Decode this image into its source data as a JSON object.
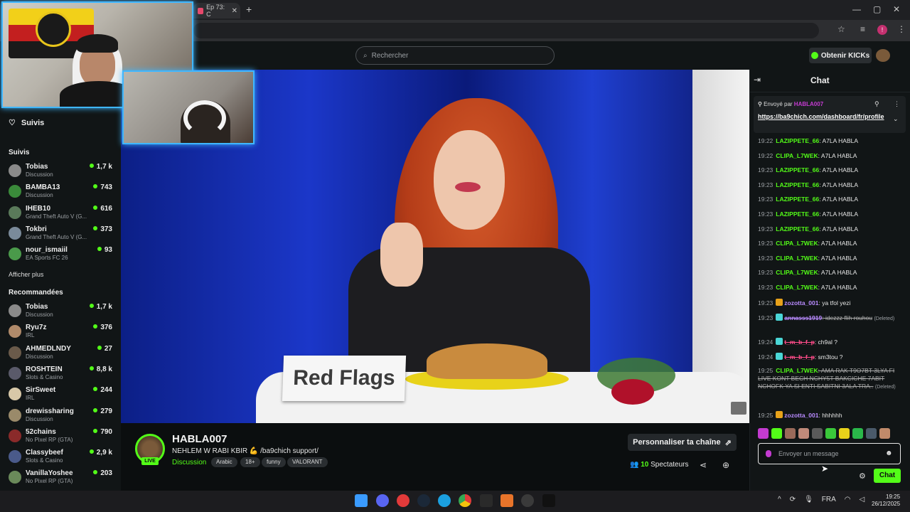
{
  "browser": {
    "tab_title": "Ep 73: C",
    "new_tab": "+",
    "close": "✕",
    "window": {
      "minimize": "—",
      "maximize": "▢",
      "close": "✕"
    },
    "profile_initial": "!"
  },
  "header": {
    "search_placeholder": "Rechercher",
    "kicks_label": "Obtenir KICKs"
  },
  "sidebar": {
    "suivis_header": "Suivis",
    "suivis_section": "Suivis",
    "followed": [
      {
        "name": "Tobias",
        "category": "Discussion",
        "viewers": "1,7 k",
        "color": "#8a8a8a"
      },
      {
        "name": "BAMBA13",
        "category": "Discussion",
        "viewers": "743",
        "color": "#3a8a3a"
      },
      {
        "name": "IHEB10",
        "category": "Grand Theft Auto V (G...",
        "viewers": "616",
        "color": "#5a7a5a"
      },
      {
        "name": "Tokbri",
        "category": "Grand Theft Auto V (G...",
        "viewers": "373",
        "color": "#7a8a9a"
      },
      {
        "name": "nour_ismaiil",
        "category": "EA Sports FC 26",
        "viewers": "93",
        "color": "#4a9a4a"
      }
    ],
    "show_more": "Afficher plus",
    "recommended_title": "Recommandées",
    "recommended": [
      {
        "name": "Tobias",
        "category": "Discussion",
        "viewers": "1,7 k",
        "color": "#8a8a8a"
      },
      {
        "name": "Ryu7z",
        "category": "IRL",
        "viewers": "376",
        "color": "#b08a6a"
      },
      {
        "name": "AHMEDLNDY",
        "category": "Discussion",
        "viewers": "27",
        "color": "#6a5a4a"
      },
      {
        "name": "ROSHTEIN",
        "category": "Slots & Casino",
        "viewers": "8,8 k",
        "color": "#5a5a6a"
      },
      {
        "name": "SirSweet",
        "category": "IRL",
        "viewers": "244",
        "color": "#d8c8a8"
      },
      {
        "name": "drewissharing",
        "category": "Discussion",
        "viewers": "279",
        "color": "#9a8a6a"
      },
      {
        "name": "52chains",
        "category": "No Pixel RP (GTA)",
        "viewers": "790",
        "color": "#8a2a2a"
      },
      {
        "name": "Classybeef",
        "category": "Slots & Casino",
        "viewers": "2,9 k",
        "color": "#4a5a8a"
      },
      {
        "name": "VanillaYoshee",
        "category": "No Pixel RP (GTA)",
        "viewers": "203",
        "color": "#6a8a5a"
      }
    ]
  },
  "video": {
    "sign_text": "Red Flags"
  },
  "stream": {
    "channel": "HABLA007",
    "live_badge": "LIVE",
    "title": "NEHLEM W RABI KBIR 💪  /ba9chich support/",
    "category": "Discussion",
    "tags": [
      "Arabic",
      "18+",
      "funny",
      "VALORANT"
    ],
    "personalize_label": "Personnaliser ta chaîne",
    "viewers_count": "10",
    "viewers_label": "Spectateurs"
  },
  "chat": {
    "title": "Chat",
    "pinned_by_label": "Envoyé par",
    "pinned_by_user": "HABLA007",
    "pinned_link": "https://ba9chich.com/dashboard/fr/profile",
    "messages": [
      {
        "time": "19:22",
        "user": "LAZIPPETE_66",
        "color": "#53fc18",
        "text": ": A7LA HABLA"
      },
      {
        "time": "19:22",
        "user": "CLIPA_L7WEK",
        "color": "#53fc18",
        "text": ": A7LA HABLA"
      },
      {
        "time": "19:23",
        "user": "LAZIPPETE_66",
        "color": "#53fc18",
        "text": ": A7LA HABLA"
      },
      {
        "time": "19:23",
        "user": "LAZIPPETE_66",
        "color": "#53fc18",
        "text": ": A7LA HABLA"
      },
      {
        "time": "19:23",
        "user": "LAZIPPETE_66",
        "color": "#53fc18",
        "text": ": A7LA HABLA"
      },
      {
        "time": "19:23",
        "user": "LAZIPPETE_66",
        "color": "#53fc18",
        "text": ": A7LA HABLA"
      },
      {
        "time": "19:23",
        "user": "LAZIPPETE_66",
        "color": "#53fc18",
        "text": ": A7LA HABLA"
      },
      {
        "time": "19:23",
        "user": "CLIPA_L7WEK",
        "color": "#53fc18",
        "text": ": A7LA HABLA"
      },
      {
        "time": "19:23",
        "user": "CLIPA_L7WEK",
        "color": "#53fc18",
        "text": ": A7LA HABLA"
      },
      {
        "time": "19:23",
        "user": "CLIPA_L7WEK",
        "color": "#53fc18",
        "text": ": A7LA HABLA"
      },
      {
        "time": "19:23",
        "user": "CLIPA_L7WEK",
        "color": "#53fc18",
        "text": ": A7LA HABLA"
      },
      {
        "time": "19:23",
        "user": "zozotta_001",
        "color": "#b98bff",
        "text": ": ya tfol yezi"
      }
    ],
    "deleted1": {
      "time": "19:23",
      "user": "annasss1919",
      "text": ": idezzz flih rouhou",
      "tag": "(Deleted)"
    },
    "msg_chbal": {
      "time": "19:24",
      "user": "t_m_b_f_p",
      "text": ": ch9al ?"
    },
    "msg_sm3tou": {
      "time": "19:24",
      "user": "t_m_b_f_p",
      "text": ": sm3tou ?"
    },
    "deleted2": {
      "time": "19:25",
      "user": "CLIPA_L7WEK",
      "text": ": AMA RAK T9O7BT 3LYA FI LIVE KONT BECH NCHY5T BAKCICHE 7ABIT NCHOFK YA SI ENTI SABITNI 3ALA TRA..",
      "tag": "(Deleted)"
    },
    "msg_last": {
      "time": "19:25",
      "user": "zozotta_001",
      "text": ": hhhhhh"
    },
    "input_placeholder": "Envoyer un message",
    "send_label": "Chat"
  },
  "taskbar": {
    "lang": "FRA",
    "time": "19:25",
    "date": "26/12/2025"
  }
}
